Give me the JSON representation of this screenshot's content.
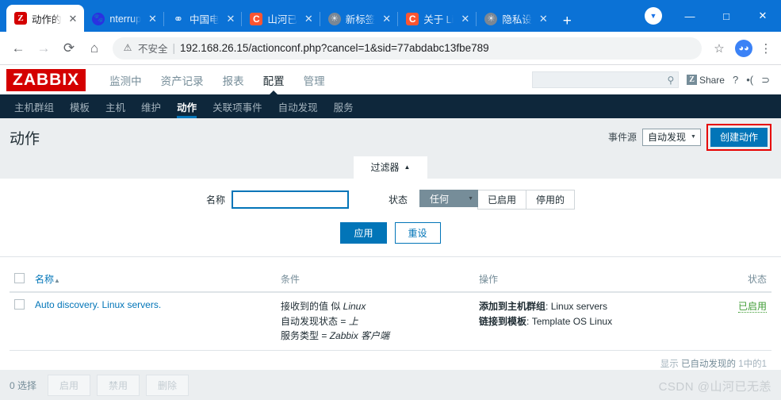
{
  "browser": {
    "tabs": [
      {
        "title": "动作的",
        "favicon": "zabbix-icon",
        "active": true,
        "close": "✕"
      },
      {
        "title": "nterrup",
        "favicon": "baidu-icon",
        "active": false,
        "close": "✕"
      },
      {
        "title": "中国电",
        "favicon": "telecom-icon",
        "active": false,
        "close": "✕"
      },
      {
        "title": "山河已",
        "favicon": "csdn-icon",
        "active": false,
        "close": "✕"
      },
      {
        "title": "新标签",
        "favicon": "globe-icon",
        "active": false,
        "close": "✕"
      },
      {
        "title": "关于 Li",
        "favicon": "csdn-icon",
        "active": false,
        "close": "✕"
      },
      {
        "title": "隐私设",
        "favicon": "globe-icon",
        "active": false,
        "close": "✕"
      }
    ],
    "new_tab_label": "+",
    "window": {
      "minimize": "—",
      "maximize": "□",
      "close": "✕"
    },
    "nav": {
      "back": "←",
      "forward": "→",
      "reload": "⟳",
      "home": "⌂"
    },
    "omnibox": {
      "warning_icon": "⚠",
      "security_label": "不安全",
      "divider": "|",
      "url": "192.168.26.15/actionconf.php?cancel=1&sid=77abdabc13fbe789"
    },
    "bookmark_star": "☆",
    "profile_initial": "",
    "menu": "⋮"
  },
  "zabbix": {
    "logo": "ZABBIX",
    "main_menu": [
      {
        "label": "监测中",
        "active": false
      },
      {
        "label": "资产记录",
        "active": false
      },
      {
        "label": "报表",
        "active": false
      },
      {
        "label": "配置",
        "active": true
      },
      {
        "label": "管理",
        "active": false
      }
    ],
    "header_right": {
      "search_placeholder": "",
      "search_icon": "search-icon",
      "share_badge": "Z",
      "share_label": "Share",
      "help_label": "?",
      "user_icon": "•(",
      "signout_icon": "⊃"
    },
    "sub_menu": [
      {
        "label": "主机群组",
        "active": false
      },
      {
        "label": "模板",
        "active": false
      },
      {
        "label": "主机",
        "active": false
      },
      {
        "label": "维护",
        "active": false
      },
      {
        "label": "动作",
        "active": true
      },
      {
        "label": "关联项事件",
        "active": false
      },
      {
        "label": "自动发现",
        "active": false
      },
      {
        "label": "服务",
        "active": false
      }
    ],
    "page_title": "动作",
    "event_source_label": "事件源",
    "event_source_value": "自动发现",
    "create_button": "创建动作",
    "highlight_color": "#e60000",
    "accent_color": "#0275b8",
    "filter": {
      "tab_label": "过滤器",
      "tab_caret": "▲",
      "name_label": "名称",
      "name_value": "",
      "name_placeholder": "",
      "status_label": "状态",
      "status_options": [
        {
          "label": "任何",
          "selected": true
        },
        {
          "label": "已启用",
          "selected": false
        },
        {
          "label": "停用的",
          "selected": false
        }
      ],
      "apply_label": "应用",
      "reset_label": "重设"
    },
    "table": {
      "columns": [
        "名称",
        "条件",
        "操作",
        "状态"
      ],
      "sort_arrow": "▲",
      "rows": [
        {
          "name": "Auto discovery. Linux servers.",
          "conditions": [
            {
              "prefix": "接收到的值 似 ",
              "value": "Linux"
            },
            {
              "prefix": "自动发现状态 = ",
              "value": "上"
            },
            {
              "prefix": "服务类型 = ",
              "value": "Zabbix 客户端"
            }
          ],
          "operations": [
            {
              "label": "添加到主机群组",
              "value": "Linux servers"
            },
            {
              "label": "链接到模板",
              "value": "Template OS Linux"
            }
          ],
          "status": "已启用"
        }
      ],
      "footer_prefix": "显示",
      "footer_source": "已自动发现的",
      "footer_count": "1中的1"
    },
    "bottom_bar": {
      "selection_count": "0 选择",
      "buttons": [
        "启用",
        "禁用",
        "删除"
      ]
    },
    "watermark": "CSDN @山河已无恙"
  }
}
